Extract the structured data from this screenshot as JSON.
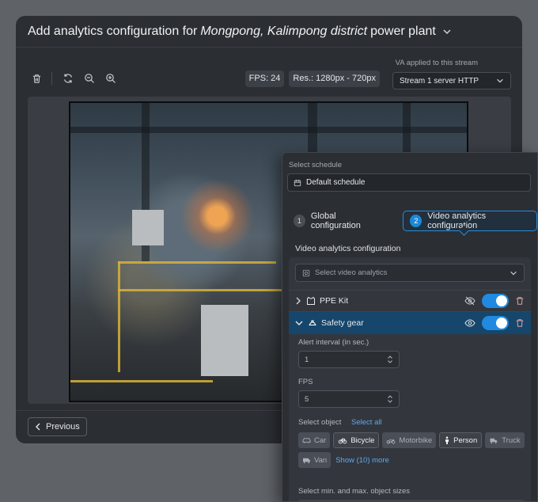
{
  "modal": {
    "title_prefix": "Add analytics configuration for ",
    "title_location": "Mongpong, Kalimpong district",
    "title_suffix": " power plant"
  },
  "toolbar": {
    "fps": "FPS: 24",
    "resolution": "Res.: 1280px - 720px",
    "va_label": "VA applied to this stream",
    "stream_value": "Stream 1 server HTTP"
  },
  "footer": {
    "previous_label": "Previous"
  },
  "panel": {
    "schedule_label": "Select schedule",
    "schedule_value": "Default schedule",
    "steps": [
      {
        "num": "1",
        "label": "Global configuration"
      },
      {
        "num": "2",
        "label": "Video analytics configuration"
      }
    ],
    "section_title": "Video analytics configuration",
    "select_va_placeholder": "Select video analytics",
    "analytics": [
      {
        "name": "PPE Kit",
        "enabled": true,
        "visible": false
      },
      {
        "name": "Safety gear",
        "enabled": true,
        "visible": true
      }
    ],
    "alert_label": "Alert interval (in sec.)",
    "alert_value": "1",
    "fps_label": "FPS",
    "fps_value": "5",
    "select_object_label": "Select object",
    "select_all": "Select all",
    "objects": [
      {
        "name": "Car",
        "selected": false
      },
      {
        "name": "Bicycle",
        "selected": true
      },
      {
        "name": "Motorbike",
        "selected": false
      },
      {
        "name": "Person",
        "selected": true
      },
      {
        "name": "Truck",
        "selected": false
      },
      {
        "name": "Van",
        "selected": false
      }
    ],
    "show_more": "Show (10) more",
    "size_label": "Select min. and max. object sizes"
  },
  "colors": {
    "accent": "#1f8ae0",
    "selected_row": "#16466b",
    "link": "#5ea8f0"
  }
}
